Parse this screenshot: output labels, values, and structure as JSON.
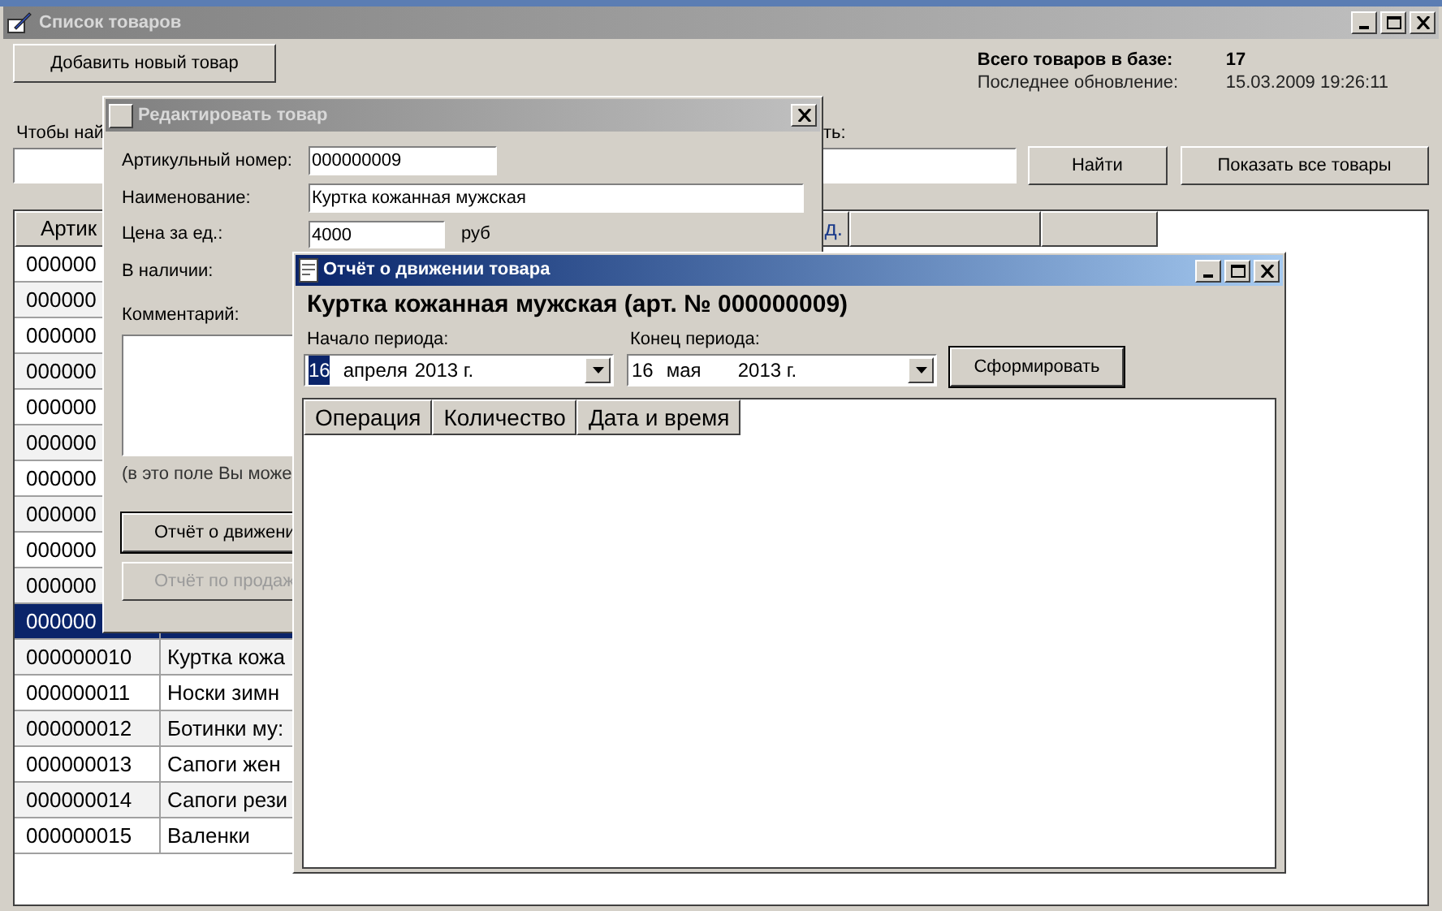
{
  "main_window": {
    "title": "Список товаров",
    "add_button": "Добавить новый товар",
    "total_label": "Всего товаров в базе:",
    "total_value": "17",
    "updated_label": "Последнее обновление:",
    "updated_value": "15.03.2009 19:26:11",
    "search_label_parts": [
      "Чтобы най",
      "ть:"
    ],
    "find_button": "Найти",
    "show_all_button": "Показать все товары"
  },
  "table": {
    "column_1": "Артик",
    "column_3": "д.",
    "rows": [
      {
        "article": "000000",
        "selected": false
      },
      {
        "article": "000000",
        "selected": false
      },
      {
        "article": "000000",
        "selected": false
      },
      {
        "article": "000000",
        "selected": false
      },
      {
        "article": "000000",
        "selected": false
      },
      {
        "article": "000000",
        "selected": false
      },
      {
        "article": "000000",
        "selected": false
      },
      {
        "article": "000000",
        "selected": false
      },
      {
        "article": "000000",
        "selected": false
      },
      {
        "article": "000000",
        "selected": false
      },
      {
        "article": "000000",
        "selected": true
      },
      {
        "article": "000000010",
        "name": "Куртка кожа",
        "selected": false
      },
      {
        "article": "000000011",
        "name": "Носки зимн",
        "selected": false
      },
      {
        "article": "000000012",
        "name": "Ботинки му:",
        "selected": false
      },
      {
        "article": "000000013",
        "name": "Сапоги жен",
        "selected": false
      },
      {
        "article": "000000014",
        "name": "Сапоги рези",
        "selected": false
      },
      {
        "article": "000000015",
        "name": "Валенки",
        "selected": false
      }
    ]
  },
  "edit_window": {
    "title": "Редактировать товар",
    "fields": [
      {
        "label": "Артикульный номер:",
        "value": "000000009",
        "kind": "short"
      },
      {
        "label": "Наименование:",
        "value": "Куртка кожанная мужская",
        "kind": "wide"
      },
      {
        "label": "Цена за ед.:",
        "value": "4000",
        "unit": "руб",
        "kind": "price"
      },
      {
        "label": "В наличии:",
        "kind": "label"
      }
    ],
    "comment_label": "Комментарий:",
    "comment_hint": "(в это поле Вы може",
    "buttons": [
      {
        "label": "Отчёт о движени",
        "disabled": false
      },
      {
        "label": "Отчёт по продаж",
        "disabled": true
      }
    ]
  },
  "report_window": {
    "title": "Отчёт о движении товара",
    "heading": "Куртка кожанная мужская (арт. № 000000009)",
    "periods": [
      {
        "label": "Начало периода:",
        "day": "16",
        "month": "апреля",
        "year": "2013 г.",
        "day_selected": true
      },
      {
        "label": "Конец периода:",
        "day": "16",
        "month": "мая",
        "year": "2013 г.",
        "day_selected": false
      }
    ],
    "generate_button": "Сформировать",
    "columns": [
      "Операция",
      "Количество",
      "Дата и время"
    ]
  }
}
